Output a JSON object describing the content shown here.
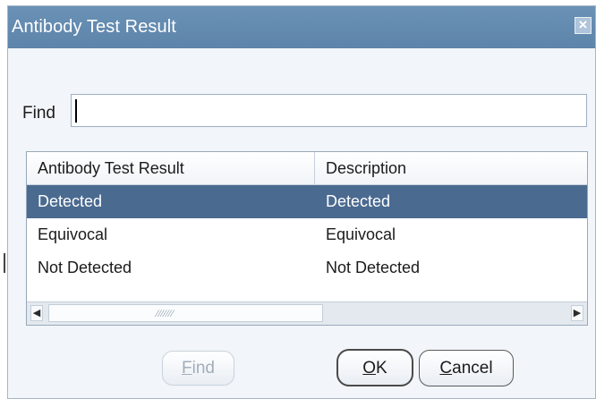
{
  "dialog": {
    "title": "Antibody Test Result",
    "close_icon": "close-icon"
  },
  "find": {
    "label": "Find",
    "value": ""
  },
  "list": {
    "columns": [
      "Antibody Test Result",
      "Description"
    ],
    "rows": [
      {
        "result": "Detected",
        "description": "Detected",
        "selected": true
      },
      {
        "result": "Equivocal",
        "description": "Equivocal",
        "selected": false
      },
      {
        "result": "Not Detected",
        "description": "Not Detected",
        "selected": false
      }
    ]
  },
  "buttons": {
    "find_label_first": "F",
    "find_label_rest": "ind",
    "ok_label_first": "O",
    "ok_label_rest": "K",
    "cancel_label_first": "C",
    "cancel_label_rest": "ancel"
  },
  "colors": {
    "titlebar": "#5d84a9",
    "selection": "#4a6a90",
    "dialog_bg": "#f2f5f9"
  }
}
